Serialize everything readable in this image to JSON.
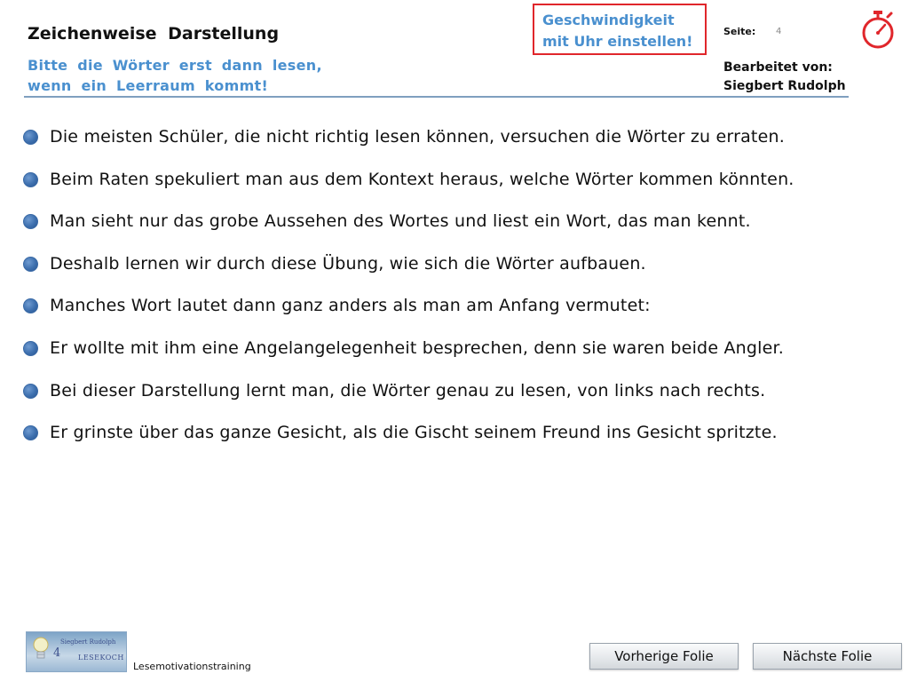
{
  "header": {
    "title": "Zeichenweise  Darstellung",
    "subtitle_line1": "Bitte  die  Wörter  erst  dann  lesen,",
    "subtitle_line2": "wenn  ein  Leerraum  kommt!",
    "speed_line1": "Geschwindigkeit",
    "speed_line2": "mit Uhr einstellen!",
    "page_label": "Seite:",
    "page_number": "4",
    "edited_by_label": "Bearbeitet von:",
    "edited_by_name": "Siegbert Rudolph"
  },
  "lines": [
    "Die  meisten  Schüler,  die  nicht  richtig  lesen  können,  versuchen  die  Wörter  zu  erraten.",
    "Beim  Raten  spekuliert man aus  dem  Kontext  heraus,  welche  Wörter kommen  könnten.",
    "Man  sieht  nur  das  grobe  Aussehen  des  Wortes  und  liest  ein  Wort,  das  man  kennt.",
    "Deshalb  lernen  wir  durch  diese  Übung,  wie  sich  die  Wörter  aufbauen.",
    "Manches  Wort  lautet  dann  ganz  anders  als  man  am  Anfang  vermutet:",
    "Er  wollte  mit  ihm  eine  Angelangelegenheit  besprechen,  denn  sie  waren  beide  Angler.",
    "Bei  dieser  Darstellung  lernt  man,  die  Wörter  genau  zu  lesen, von links nach rechts.",
    "Er  grinste  über  das  ganze  Gesicht,  als  die  Gischt  seinem  Freund  ins  Gesicht  spritzte."
  ],
  "footer": {
    "logo_digit": "4",
    "logo_name": "Siegbert Rudolph",
    "logo_brand": "LESEKOCH",
    "caption": "Lesemotivationstraining",
    "prev_label": "Vorherige  Folie",
    "next_label": "Nächste  Folie"
  },
  "icons": {
    "stopwatch": "stopwatch-icon",
    "bullet": "bullet-icon",
    "logo_bulb": "lightbulb-icon"
  },
  "colors": {
    "accent_blue": "#4a90cf",
    "alert_red": "#e0262b",
    "bullet_blue": "#3d6fae"
  }
}
